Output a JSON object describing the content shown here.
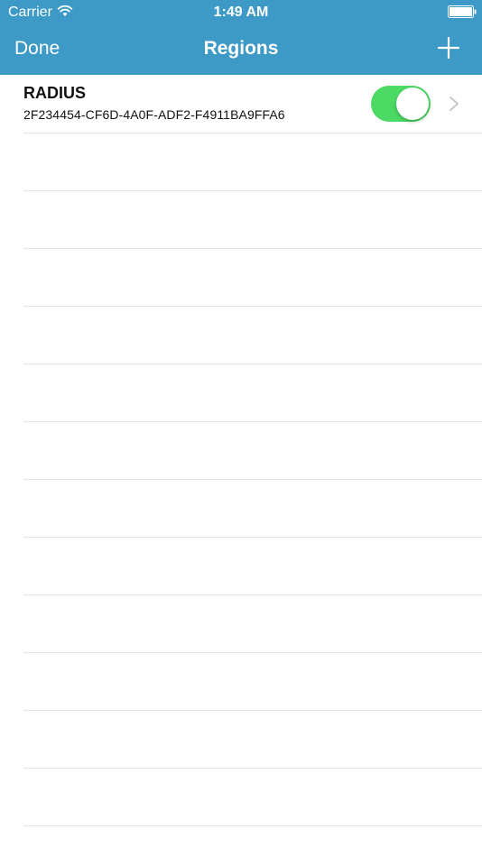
{
  "status_bar": {
    "carrier": "Carrier",
    "time": "1:49 AM",
    "wifi_icon": "wifi-icon",
    "battery_icon": "battery-icon"
  },
  "nav": {
    "done_label": "Done",
    "title": "Regions",
    "add_icon": "plus-icon"
  },
  "colors": {
    "nav_background": "#3d9ac7",
    "toggle_on": "#4cd964",
    "separator": "#e3e3e3"
  },
  "regions": [
    {
      "name": "RADIUS",
      "uuid": "2F234454-CF6D-4A0F-ADF2-F4911BA9FFA6",
      "enabled": true,
      "accessory_icon": "chevron-right-icon"
    }
  ]
}
